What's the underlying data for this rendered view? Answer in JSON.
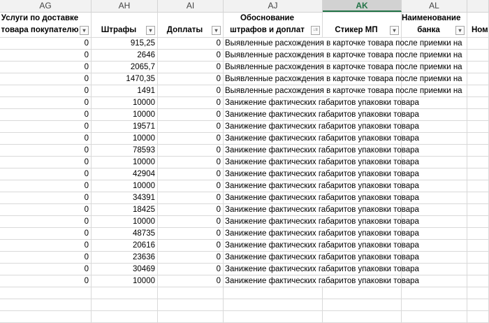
{
  "columns": [
    {
      "letter": "AG",
      "header": "Услуги по доставке товара покупателю",
      "filter_icon": "chevron-down-icon"
    },
    {
      "letter": "AH",
      "header": "Штрафы",
      "filter_icon": "chevron-down-icon"
    },
    {
      "letter": "AI",
      "header": "Доплаты",
      "filter_icon": "chevron-down-icon"
    },
    {
      "letter": "AJ",
      "header": "Обоснование штрафов и доплат",
      "filter_icon": "sort-filter-icon"
    },
    {
      "letter": "AK",
      "header": "Стикер МП",
      "filter_icon": "chevron-down-icon",
      "selected": true
    },
    {
      "letter": "AL",
      "header": "Наименование банка",
      "filter_icon": "chevron-down-icon"
    },
    {
      "letter": "",
      "header": "Ном"
    }
  ],
  "rows": [
    {
      "delivery": "0",
      "fine": "915,25",
      "surcharge": "0",
      "reason": "Выявленные расхождения в карточке товара после приемки на"
    },
    {
      "delivery": "0",
      "fine": "2646",
      "surcharge": "0",
      "reason": "Выявленные расхождения в карточке товара после приемки на"
    },
    {
      "delivery": "0",
      "fine": "2065,7",
      "surcharge": "0",
      "reason": "Выявленные расхождения в карточке товара после приемки на"
    },
    {
      "delivery": "0",
      "fine": "1470,35",
      "surcharge": "0",
      "reason": "Выявленные расхождения в карточке товара после приемки на"
    },
    {
      "delivery": "0",
      "fine": "1491",
      "surcharge": "0",
      "reason": "Выявленные расхождения в карточке товара после приемки на"
    },
    {
      "delivery": "0",
      "fine": "10000",
      "surcharge": "0",
      "reason": "Занижение фактических габаритов упаковки товара"
    },
    {
      "delivery": "0",
      "fine": "10000",
      "surcharge": "0",
      "reason": "Занижение фактических габаритов упаковки товара"
    },
    {
      "delivery": "0",
      "fine": "19571",
      "surcharge": "0",
      "reason": "Занижение фактических габаритов упаковки товара"
    },
    {
      "delivery": "0",
      "fine": "10000",
      "surcharge": "0",
      "reason": "Занижение фактических габаритов упаковки товара"
    },
    {
      "delivery": "0",
      "fine": "78593",
      "surcharge": "0",
      "reason": "Занижение фактических габаритов упаковки товара"
    },
    {
      "delivery": "0",
      "fine": "10000",
      "surcharge": "0",
      "reason": "Занижение фактических габаритов упаковки товара"
    },
    {
      "delivery": "0",
      "fine": "42904",
      "surcharge": "0",
      "reason": "Занижение фактических габаритов упаковки товара"
    },
    {
      "delivery": "0",
      "fine": "10000",
      "surcharge": "0",
      "reason": "Занижение фактических габаритов упаковки товара"
    },
    {
      "delivery": "0",
      "fine": "34391",
      "surcharge": "0",
      "reason": "Занижение фактических габаритов упаковки товара"
    },
    {
      "delivery": "0",
      "fine": "18425",
      "surcharge": "0",
      "reason": "Занижение фактических габаритов упаковки товара"
    },
    {
      "delivery": "0",
      "fine": "10000",
      "surcharge": "0",
      "reason": "Занижение фактических габаритов упаковки товара"
    },
    {
      "delivery": "0",
      "fine": "48735",
      "surcharge": "0",
      "reason": "Занижение фактических габаритов упаковки товара"
    },
    {
      "delivery": "0",
      "fine": "20616",
      "surcharge": "0",
      "reason": "Занижение фактических габаритов упаковки товара"
    },
    {
      "delivery": "0",
      "fine": "23636",
      "surcharge": "0",
      "reason": "Занижение фактических габаритов упаковки товара"
    },
    {
      "delivery": "0",
      "fine": "30469",
      "surcharge": "0",
      "reason": "Занижение фактических габаритов упаковки товара"
    },
    {
      "delivery": "0",
      "fine": "10000",
      "surcharge": "0",
      "reason": "Занижение фактических габаритов упаковки товара"
    }
  ],
  "colors": {
    "selected_column": "#217346",
    "grid": "#d9d9d9"
  }
}
